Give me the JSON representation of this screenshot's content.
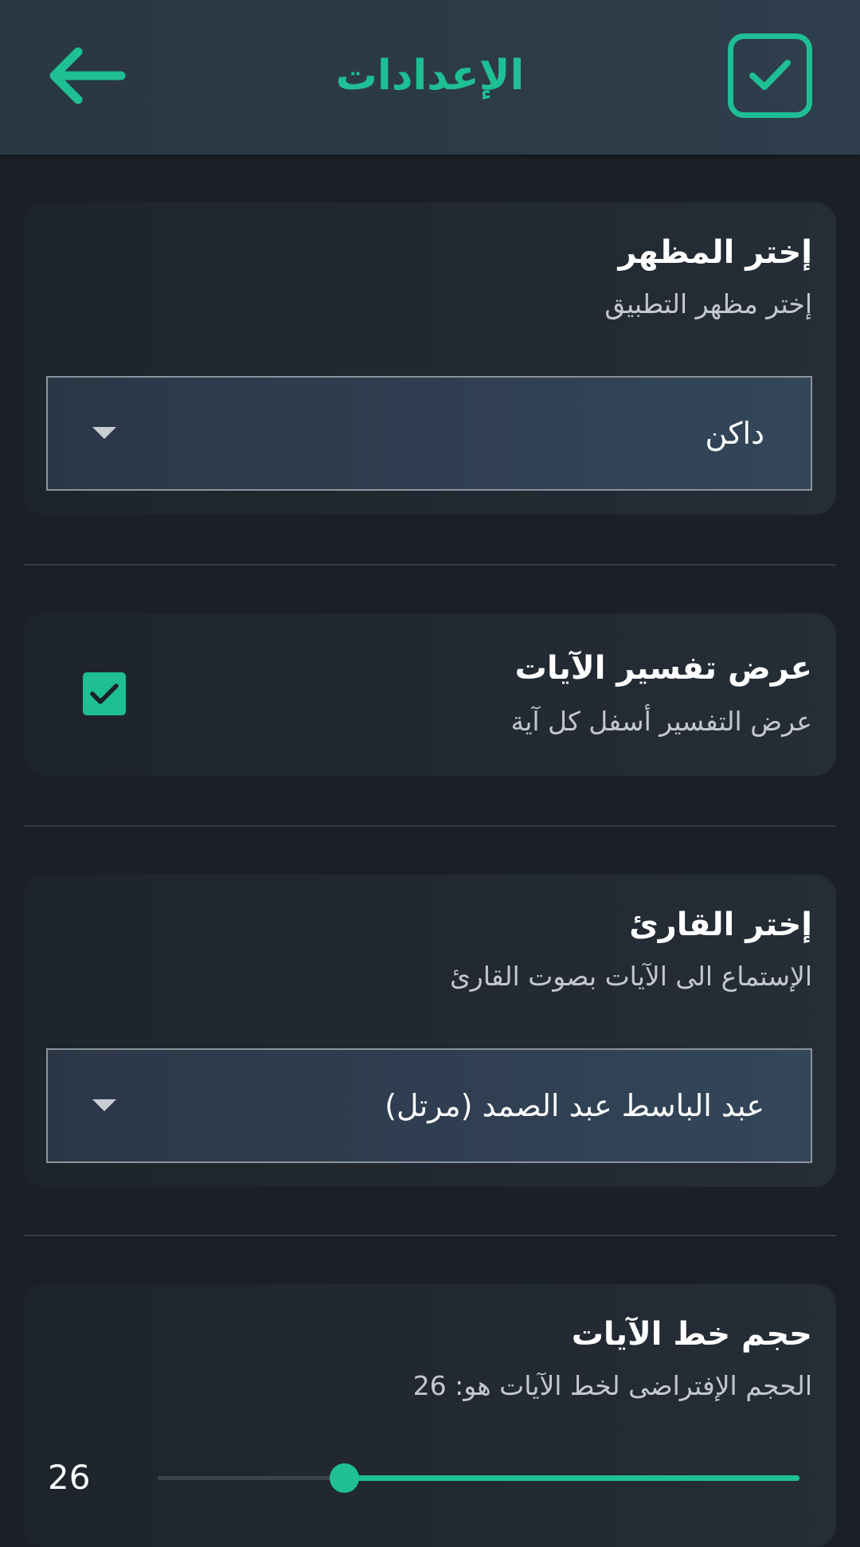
{
  "header": {
    "title": "الإعدادات",
    "back_icon": "arrow-left-icon",
    "save_icon": "checkbox-check-icon"
  },
  "theme": {
    "title": "إختر المظهر",
    "subtitle": "إختر مظهر التطبيق",
    "selected": "داكن"
  },
  "tafsir": {
    "title": "عرض تفسير الآيات",
    "subtitle": "عرض التفسير أسفل كل آية",
    "checked": true
  },
  "reciter": {
    "title": "إختر القارئ",
    "subtitle": "الإستماع الى الآيات بصوت القارئ",
    "selected": "عبد الباسط عبد الصمد (مرتل)"
  },
  "font_size": {
    "title": "حجم خط الآيات",
    "subtitle": "الحجم الإفتراضى لخط الآيات هو: 26",
    "value": "26",
    "fraction": 0.29
  },
  "colors": {
    "accent": "#1fbf95",
    "background": "#1b2027",
    "card": "#232a33"
  }
}
